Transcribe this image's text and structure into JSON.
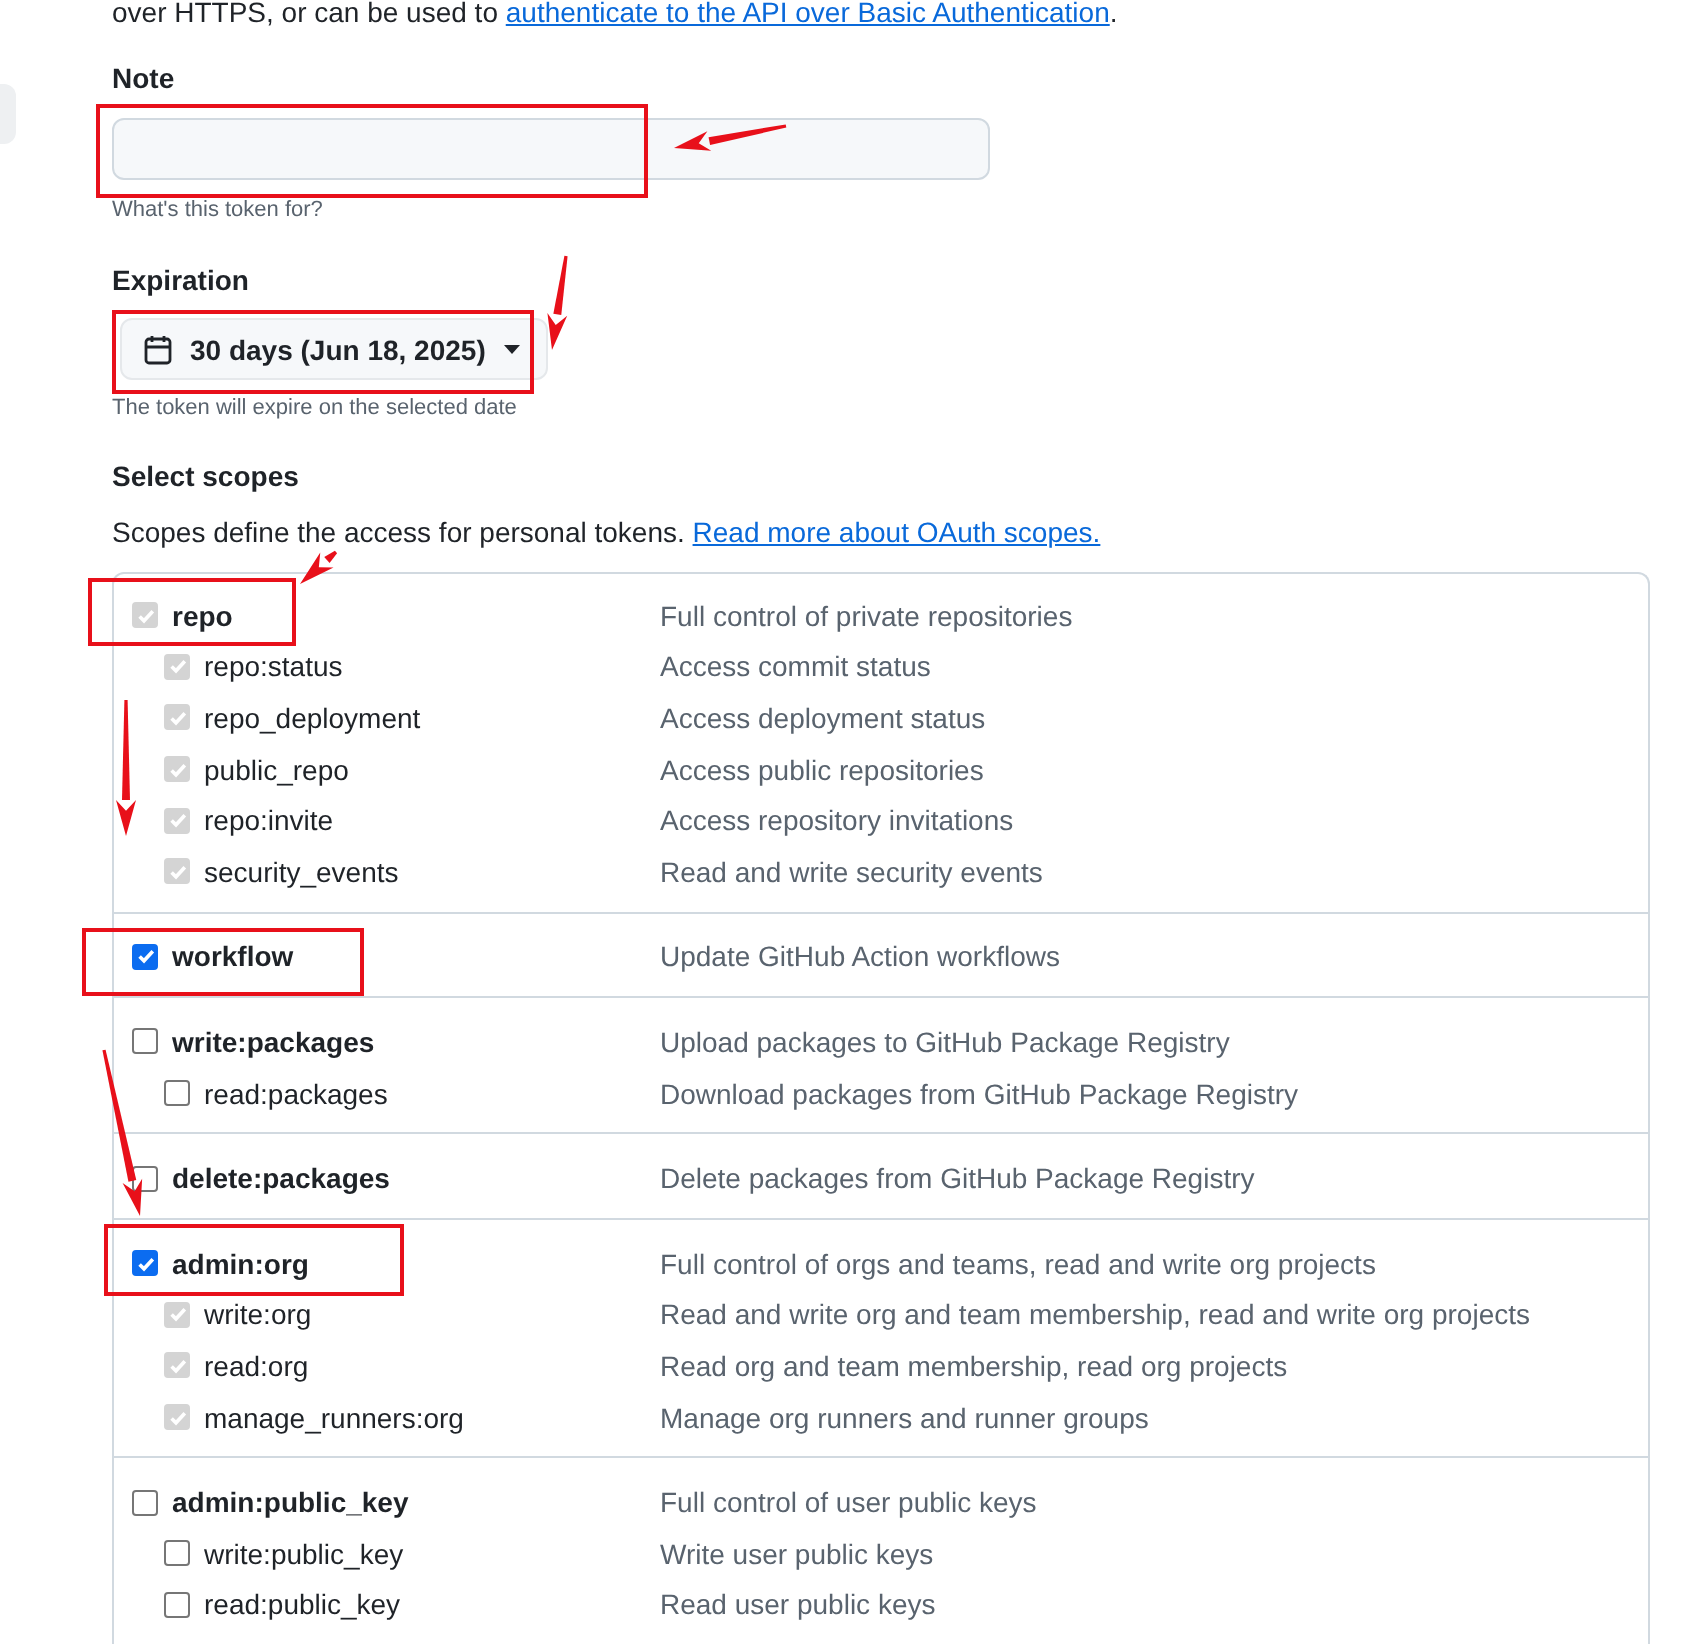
{
  "intro": {
    "text": "over HTTPS, or can be used to ",
    "link": "authenticate to the API over Basic Authentication",
    "after": "."
  },
  "note": {
    "label": "Note",
    "hint": "What's this token for?"
  },
  "expiration": {
    "label": "Expiration",
    "value": "30 days (Jun 18, 2025)",
    "hint": "The token will expire on the selected date"
  },
  "scopes_heading": "Select scopes",
  "scopes_intro": {
    "text": "Scopes define the access for personal tokens. ",
    "link": "Read more about OAuth scopes."
  },
  "scopes": [
    {
      "name": "repo",
      "description": "Full control of private repositories",
      "checked": true,
      "disabled": true,
      "children": [
        {
          "name": "repo:status",
          "description": "Access commit status",
          "checked": true,
          "disabled": true
        },
        {
          "name": "repo_deployment",
          "description": "Access deployment status",
          "checked": true,
          "disabled": true
        },
        {
          "name": "public_repo",
          "description": "Access public repositories",
          "checked": true,
          "disabled": true
        },
        {
          "name": "repo:invite",
          "description": "Access repository invitations",
          "checked": true,
          "disabled": true
        },
        {
          "name": "security_events",
          "description": "Read and write security events",
          "checked": true,
          "disabled": true
        }
      ]
    },
    {
      "name": "workflow",
      "description": "Update GitHub Action workflows",
      "checked": true,
      "disabled": false
    },
    {
      "name": "write:packages",
      "description": "Upload packages to GitHub Package Registry",
      "checked": false,
      "disabled": false,
      "children": [
        {
          "name": "read:packages",
          "description": "Download packages from GitHub Package Registry",
          "checked": false,
          "disabled": false
        }
      ]
    },
    {
      "name": "delete:packages",
      "description": "Delete packages from GitHub Package Registry",
      "checked": false,
      "disabled": false
    },
    {
      "name": "admin:org",
      "description": "Full control of orgs and teams, read and write org projects",
      "checked": true,
      "disabled": false,
      "children": [
        {
          "name": "write:org",
          "description": "Read and write org and team membership, read and write org projects",
          "checked": true,
          "disabled": true
        },
        {
          "name": "read:org",
          "description": "Read org and team membership, read org projects",
          "checked": true,
          "disabled": true
        },
        {
          "name": "manage_runners:org",
          "description": "Manage org runners and runner groups",
          "checked": true,
          "disabled": true
        }
      ]
    },
    {
      "name": "admin:public_key",
      "description": "Full control of user public keys",
      "checked": false,
      "disabled": false,
      "children": [
        {
          "name": "write:public_key",
          "description": "Write user public keys",
          "checked": false,
          "disabled": false
        },
        {
          "name": "read:public_key",
          "description": "Read user public keys",
          "checked": false,
          "disabled": false
        }
      ]
    }
  ],
  "annotations_shown": true
}
